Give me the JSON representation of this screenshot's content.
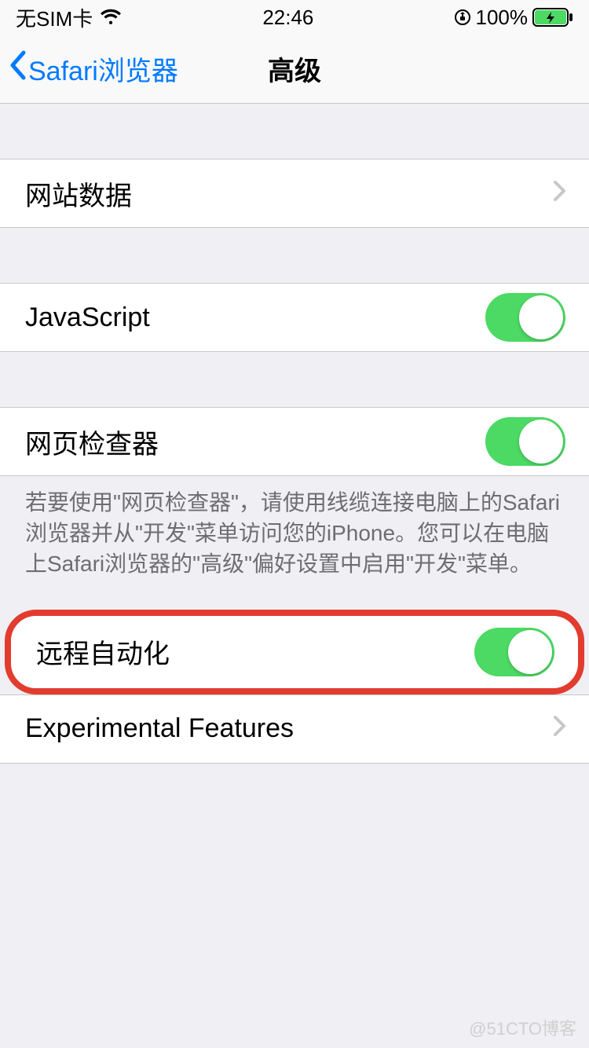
{
  "status_bar": {
    "carrier": "无SIM卡",
    "time": "22:46",
    "battery_pct": "100%"
  },
  "nav": {
    "back_label": "Safari浏览器",
    "title": "高级"
  },
  "rows": {
    "website_data": {
      "label": "网站数据"
    },
    "javascript": {
      "label": "JavaScript",
      "on": true
    },
    "web_inspector": {
      "label": "网页检查器",
      "on": true
    },
    "web_inspector_footer": "若要使用\"网页检查器\"，请使用线缆连接电脑上的Safari浏览器并从\"开发\"菜单访问您的iPhone。您可以在电脑上Safari浏览器的\"高级\"偏好设置中启用\"开发\"菜单。",
    "remote_automation": {
      "label": "远程自动化",
      "on": true
    },
    "experimental": {
      "label": "Experimental Features"
    }
  },
  "watermark": "@51CTO博客"
}
